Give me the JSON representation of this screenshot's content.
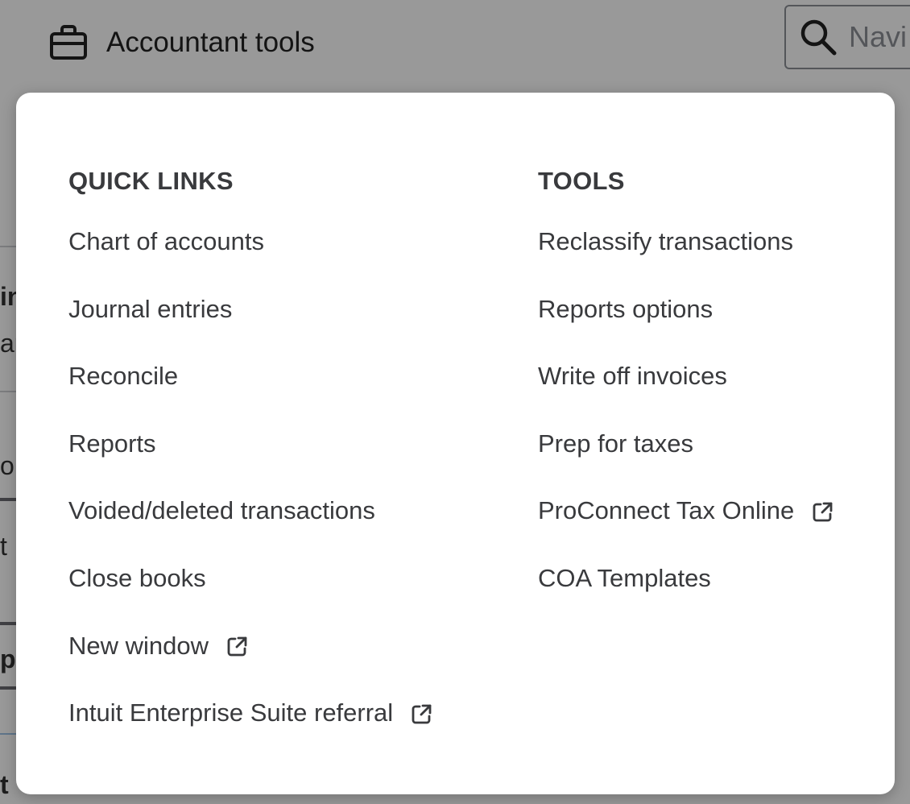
{
  "header": {
    "title": "Accountant tools",
    "title_icon": "briefcase-icon",
    "search": {
      "placeholder": "Navi",
      "icon": "search-icon"
    }
  },
  "background_fragments": [
    "in",
    "ar",
    "o",
    "t",
    "p",
    "t"
  ],
  "menu": {
    "quick_links": {
      "heading": "QUICK LINKS",
      "items": [
        {
          "label": "Chart of accounts",
          "external": false
        },
        {
          "label": "Journal entries",
          "external": false
        },
        {
          "label": "Reconcile",
          "external": false
        },
        {
          "label": "Reports",
          "external": false
        },
        {
          "label": "Voided/deleted transactions",
          "external": false
        },
        {
          "label": "Close books",
          "external": false
        },
        {
          "label": "New window",
          "external": true
        },
        {
          "label": "Intuit Enterprise Suite referral",
          "external": true
        }
      ]
    },
    "tools": {
      "heading": "TOOLS",
      "items": [
        {
          "label": "Reclassify transactions",
          "external": false
        },
        {
          "label": "Reports options",
          "external": false
        },
        {
          "label": "Write off invoices",
          "external": false
        },
        {
          "label": "Prep for taxes",
          "external": false
        },
        {
          "label": "ProConnect Tax Online",
          "external": true
        },
        {
          "label": "COA Templates",
          "external": false
        }
      ]
    },
    "external_link_icon": "external-link-icon"
  },
  "colors": {
    "text": "#393a3d",
    "overlay": "rgba(0,0,0,0.40)",
    "panel_bg": "#ffffff"
  }
}
